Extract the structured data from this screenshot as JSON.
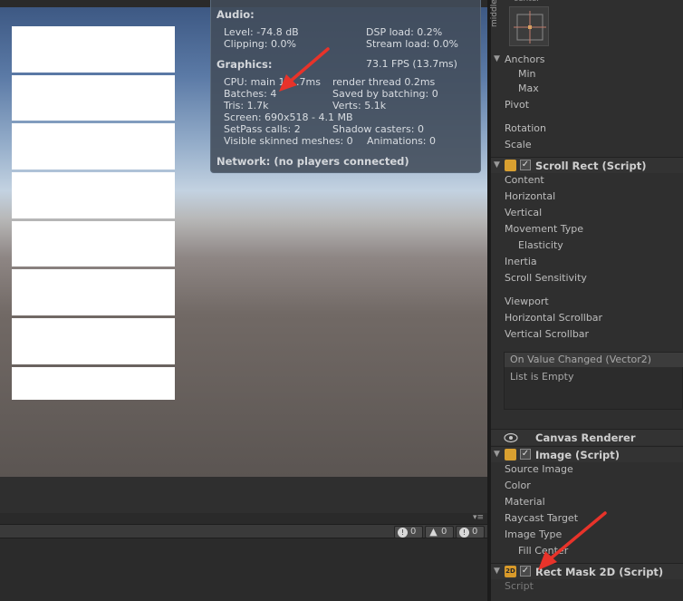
{
  "stats": {
    "audio_heading": "Audio:",
    "level": "Level: -74.8 dB",
    "dsp_load": "DSP load: 0.2%",
    "clipping": "Clipping: 0.0%",
    "stream_load": "Stream load: 0.0%",
    "graphics_heading": "Graphics:",
    "fps": "73.1 FPS (13.7ms)",
    "cpu": "CPU: main 1",
    "cpu_ms": ".7ms",
    "render_thread": "render thread 0.2ms",
    "batches": "Batches: 4",
    "saved_by_batching": "Saved by batching: 0",
    "tris": "Tris: 1.7k",
    "verts": "Verts: 5.1k",
    "screen": "Screen: 690x518 - 4.1 MB",
    "setpass": "SetPass calls: 2",
    "shadow_casters": "Shadow casters: 0",
    "skinned": "Visible skinned meshes: 0",
    "animations": "Animations: 0",
    "network": "Network: (no players connected)"
  },
  "console": {
    "errors": "0",
    "warnings": "0",
    "logs": "0"
  },
  "inspector": {
    "anchor_preset_top": "center",
    "anchor_preset_side": "middle",
    "anchors": "Anchors",
    "min": "Min",
    "max": "Max",
    "pivot": "Pivot",
    "rotation": "Rotation",
    "scale": "Scale",
    "scroll_rect": {
      "title": "Scroll Rect (Script)",
      "content": "Content",
      "horizontal": "Horizontal",
      "vertical": "Vertical",
      "movement_type": "Movement Type",
      "elasticity": "Elasticity",
      "inertia": "Inertia",
      "scroll_sensitivity": "Scroll Sensitivity",
      "viewport": "Viewport",
      "horizontal_scrollbar": "Horizontal Scrollbar",
      "vertical_scrollbar": "Vertical Scrollbar",
      "on_value_changed": "On Value Changed (Vector2)",
      "list_empty": "List is Empty"
    },
    "canvas_renderer": {
      "title": "Canvas Renderer"
    },
    "image": {
      "title": "Image (Script)",
      "source_image": "Source Image",
      "color": "Color",
      "material": "Material",
      "raycast_target": "Raycast Target",
      "image_type": "Image Type",
      "fill_center": "Fill Center"
    },
    "rect_mask": {
      "icon_label": "2D",
      "title": "Rect Mask 2D (Script)",
      "script": "Script"
    }
  },
  "colors": {
    "arrow": "#e8332a",
    "image_icon": "#d9a030",
    "mask_icon": "#d99a2a"
  }
}
